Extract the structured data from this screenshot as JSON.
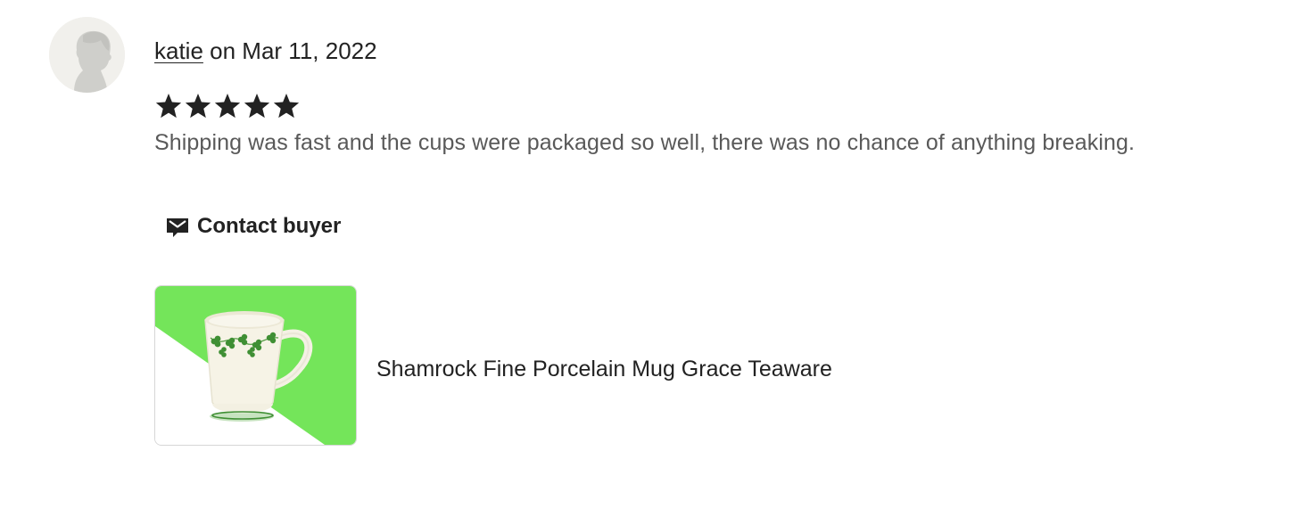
{
  "review": {
    "reviewer": "katie",
    "date_prefix": " on ",
    "date": "Mar 11, 2022",
    "rating": 5,
    "max_rating": 5,
    "text": "Shipping was fast and the cups were packaged so well, there was no chance of anything breaking."
  },
  "actions": {
    "contact_buyer_label": "Contact buyer",
    "contact_icon": "mail-icon"
  },
  "product": {
    "title": "Shamrock Fine Porcelain Mug Grace Teaware",
    "image_alt": "product-photo-icon"
  },
  "colors": {
    "text_primary": "#222222",
    "text_secondary": "#595959",
    "star": "#222222",
    "photo_green": "#74e55a",
    "avatar_bg": "#f1f0ec"
  }
}
